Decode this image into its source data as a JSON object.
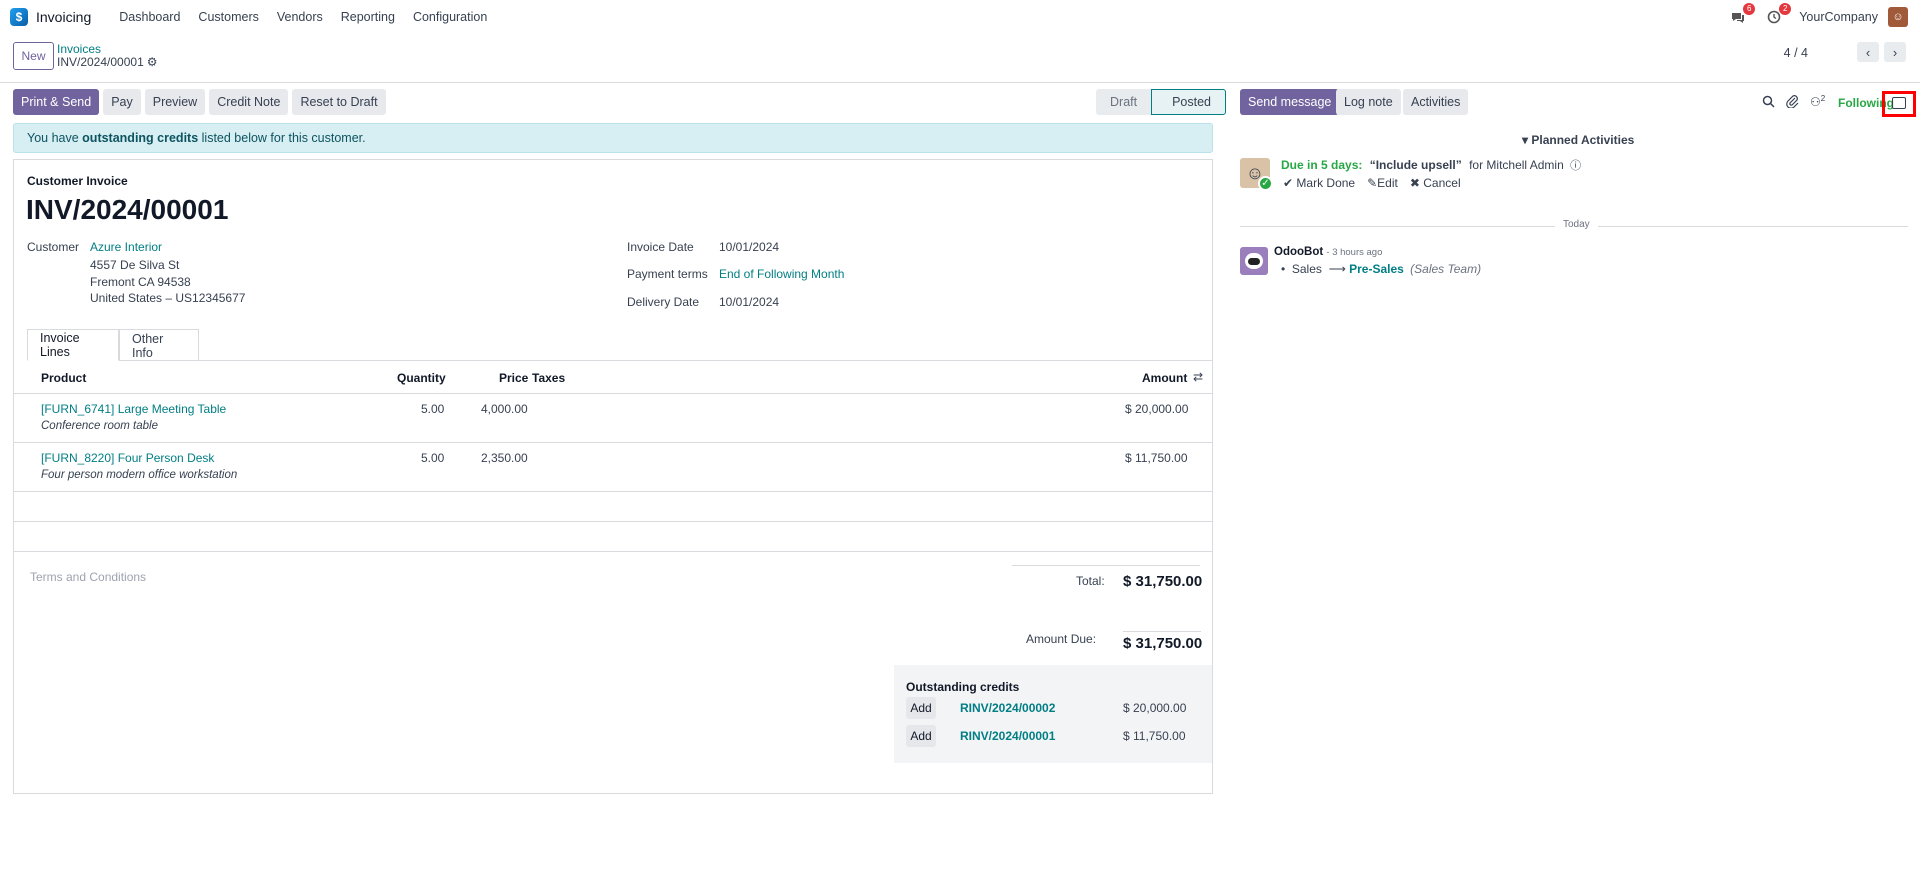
{
  "topbar": {
    "app_name": "Invoicing",
    "menu": [
      "Dashboard",
      "Customers",
      "Vendors",
      "Reporting",
      "Configuration"
    ],
    "messages_badge": "6",
    "activities_badge": "2",
    "company": "YourCompany"
  },
  "control": {
    "new_label": "New",
    "breadcrumb_parent": "Invoices",
    "breadcrumb_current": "INV/2024/00001",
    "pager": "4 / 4"
  },
  "actions": [
    "Print & Send",
    "Pay",
    "Preview",
    "Credit Note",
    "Reset to Draft"
  ],
  "statusbar": {
    "draft": "Draft",
    "posted": "Posted"
  },
  "alert": {
    "pre": "You have ",
    "bold": "outstanding credits",
    "post": " listed below for this customer."
  },
  "invoice": {
    "type_label": "Customer Invoice",
    "number": "INV/2024/00001",
    "customer_label": "Customer",
    "customer_name": "Azure Interior",
    "address": [
      "4557 De Silva St",
      "Fremont CA 94538",
      "United States – US12345677"
    ],
    "invoice_date_label": "Invoice Date",
    "invoice_date": "10/01/2024",
    "payment_terms_label": "Payment terms",
    "payment_terms": "End of Following Month",
    "delivery_date_label": "Delivery Date",
    "delivery_date": "10/01/2024"
  },
  "tabs": [
    "Invoice Lines",
    "Other Info"
  ],
  "lines": {
    "headers": {
      "product": "Product",
      "quantity": "Quantity",
      "price": "Price",
      "taxes": "Taxes",
      "amount": "Amount"
    },
    "rows": [
      {
        "product": "[FURN_6741] Large Meeting Table",
        "desc": "Conference room table",
        "qty": "5.00",
        "price": "4,000.00",
        "amount": "$ 20,000.00"
      },
      {
        "product": "[FURN_8220] Four Person Desk",
        "desc": "Four person modern office workstation",
        "qty": "5.00",
        "price": "2,350.00",
        "amount": "$ 11,750.00"
      }
    ]
  },
  "terms_placeholder": "Terms and Conditions",
  "totals": {
    "total_label": "Total:",
    "total": "$ 31,750.00",
    "due_label": "Amount Due:",
    "due": "$ 31,750.00"
  },
  "credits": {
    "title": "Outstanding credits",
    "add_label": "Add",
    "items": [
      {
        "ref": "RINV/2024/00002",
        "amount": "$ 20,000.00"
      },
      {
        "ref": "RINV/2024/00001",
        "amount": "$ 11,750.00"
      }
    ]
  },
  "chatter": {
    "send_message": "Send message",
    "log_note": "Log note",
    "activities": "Activities",
    "followers_count": "2",
    "following": "Following",
    "planned_title": "Planned Activities",
    "due_text": "Due in 5 days:",
    "activity_summary": "“Include upsell”",
    "activity_for": "for Mitchell Admin",
    "mark_done": "Mark Done",
    "edit": "Edit",
    "cancel": "Cancel",
    "today": "Today",
    "bot_name": "OdooBot",
    "bot_time": "- 3 hours ago",
    "change_from": "Sales",
    "change_to": "Pre-Sales",
    "change_field": "(Sales Team)"
  }
}
